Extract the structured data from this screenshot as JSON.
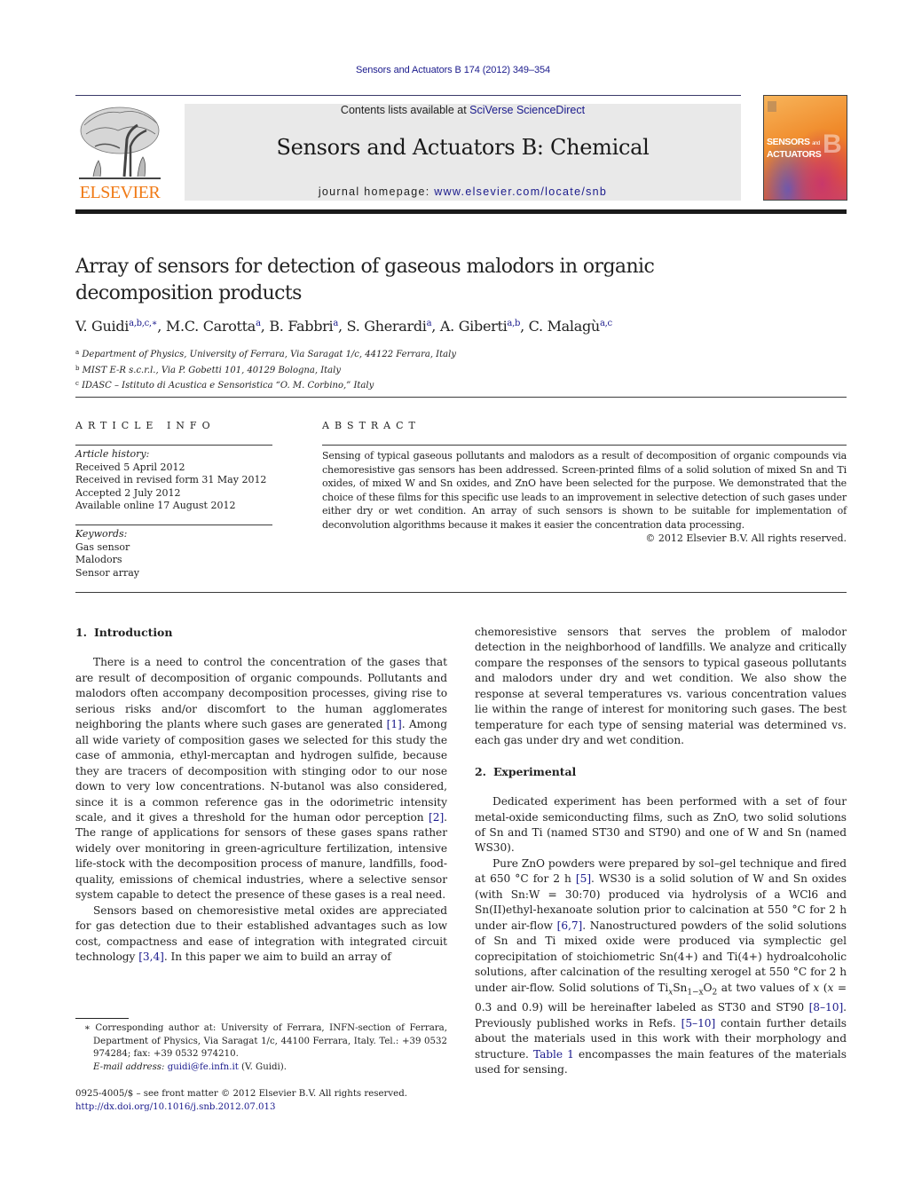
{
  "header": {
    "citation": "Sensors and Actuators B 174 (2012) 349–354",
    "contents_prefix": "Contents lists available at ",
    "contents_link": "SciVerse ScienceDirect",
    "journal_title": "Sensors and Actuators B: Chemical",
    "homepage_prefix": "journal homepage: ",
    "homepage_link": "www.elsevier.com/locate/snb",
    "publisher_logo_text": "ELSEVIER",
    "cover_title_line1": "SENSORS",
    "cover_title_and": "and",
    "cover_title_line2": "ACTUATORS",
    "cover_letter": "B",
    "brand_color": "#f07a16",
    "link_color": "#1a1a8c"
  },
  "article": {
    "title_line1": "Array of sensors for detection of gaseous malodors in organic",
    "title_line2": "decomposition products",
    "authors": [
      {
        "name": "V. Guidi",
        "sup": "a,b,c,∗"
      },
      {
        "name": "M.C. Carotta",
        "sup": "a"
      },
      {
        "name": "B. Fabbri",
        "sup": "a"
      },
      {
        "name": "S. Gherardi",
        "sup": "a"
      },
      {
        "name": "A. Giberti",
        "sup": "a,b"
      },
      {
        "name": "C. Malagù",
        "sup": "a,c"
      }
    ],
    "affiliations": [
      {
        "key": "a",
        "text": "Department of Physics, University of Ferrara, Via Saragat 1/c, 44122 Ferrara, Italy"
      },
      {
        "key": "b",
        "text": "MIST E-R s.c.r.l., Via P. Gobetti 101, 40129 Bologna, Italy"
      },
      {
        "key": "c",
        "text": "IDASC – Istituto di Acustica e Sensoristica “O. M. Corbino,” Italy"
      }
    ]
  },
  "article_info": {
    "heading": "ARTICLE INFO",
    "history_label": "Article history:",
    "history": [
      "Received 5 April 2012",
      "Received in revised form 31 May 2012",
      "Accepted 2 July 2012",
      "Available online 17 August 2012"
    ],
    "keywords_label": "Keywords:",
    "keywords": [
      "Gas sensor",
      "Malodors",
      "Sensor array"
    ]
  },
  "abstract": {
    "heading": "ABSTRACT",
    "text": "Sensing of typical gaseous pollutants and malodors as a result of decomposition of organic compounds via chemoresistive gas sensors has been addressed. Screen-printed films of a solid solution of mixed Sn and Ti oxides, of mixed W and Sn oxides, and ZnO have been selected for the purpose. We demonstrated that the choice of these films for this specific use leads to an improvement in selective detection of such gases under either dry or wet condition. An array of such sensors is shown to be suitable for implementation of deconvolution algorithms because it makes it easier the concentration data processing.",
    "copyright": "© 2012 Elsevier B.V. All rights reserved."
  },
  "body": {
    "sec1": {
      "num": "1.",
      "title": "Introduction",
      "p1_a": "There is a need to control the concentration of the gases that are result of decomposition of organic compounds. Pollutants and malodors often accompany decomposition processes, giving rise to serious risks and/or discomfort to the human agglomerates neighboring the plants where such gases are generated ",
      "p1_ref1": "[1]",
      "p1_b": ". Among all wide variety of composition gases we selected for this study the case of ammonia, ethyl-mercaptan and hydrogen sulfide, because they are tracers of decomposition with stinging odor to our nose down to very low concentrations. N-butanol was also considered, since it is a common reference gas in the odorimetric intensity scale, and it gives a threshold for the human odor perception ",
      "p1_ref2": "[2]",
      "p1_c": ". The range of applications for sensors of these gases spans rather widely over monitoring in green-agriculture fertilization, intensive life-stock with the decomposition process of manure, landfills, food-quality, emissions of chemical industries, where a selective sensor system capable to detect the presence of these gases is a real need.",
      "p2_a": "Sensors based on chemoresistive metal oxides are appreciated for gas detection due to their established advantages such as low cost, compactness and ease of integration with integrated circuit technology ",
      "p2_ref": "[3,4]",
      "p2_b": ". In this paper we aim to build an array of ",
      "p2_c": "chemoresistive sensors that serves the problem of malodor detection in the neighborhood of landfills. We analyze and critically compare the responses of the sensors to typical gaseous pollutants and malodors under dry and wet condition. We also show the response at several temperatures vs. various concentration values lie within the range of interest for monitoring such gases. The best temperature for each type of sensing material was determined vs. each gas under dry and wet condition."
    },
    "sec2": {
      "num": "2.",
      "title": "Experimental",
      "p1": "Dedicated experiment has been performed with a set of four metal-oxide semiconducting films, such as ZnO, two solid solutions of Sn and Ti (named ST30 and ST90) and one of W and Sn (named WS30).",
      "p2_a": "Pure ZnO powders were prepared by sol–gel technique and fired at 650 °C for 2 h ",
      "p2_ref1": "[5]",
      "p2_b": ". WS30 is a solid solution of W and Sn oxides (with Sn:W = 30:70) produced via hydrolysis of a WCl6 and Sn(II)ethyl-hexanoate solution prior to calcination at 550 °C for 2 h under air-flow ",
      "p2_ref2": "[6,7]",
      "p2_c": ". Nanostructured powders of the solid solutions of Sn and Ti mixed oxide were produced via symplectic gel coprecipitation of stoichiometric Sn(4+) and Ti(4+) hydroalcoholic solutions, after calcination of the resulting xerogel at 550 °C for 2 h under air-flow. Solid solutions of Ti",
      "p2_sub_x": "x",
      "p2_sn": "Sn",
      "p2_sub_1x": "1−x",
      "p2_o": "O",
      "p2_sub_2": "2",
      "p2_d": " at two values of ",
      "p2_x_italic": "x",
      "p2_e": " (",
      "p2_x_italic2": "x",
      "p2_f": " = 0.3 and 0.9) will be hereinafter labeled as ST30 and ST90 ",
      "p2_ref3": "[8–10]",
      "p2_g": ". Previously published works in Refs. ",
      "p2_ref4": "[5–10]",
      "p2_h": " contain further details about the materials used in this work with their morphology and structure. ",
      "p2_table_ref": "Table 1",
      "p2_i": " encompasses the main features of the materials used for sensing."
    }
  },
  "footnotes": {
    "corresponding": "∗ Corresponding author at: University of Ferrara, INFN-section of Ferrara, Department of Physics, Via Saragat 1/c, 44100 Ferrara, Italy. Tel.: +39 0532 974284; fax: +39 0532 974210.",
    "email_label": "E-mail address: ",
    "email": "guidi@fe.infn.it",
    "email_suffix": " (V. Guidi).",
    "issn": "0925-4005/$ – see front matter © 2012 Elsevier B.V. All rights reserved.",
    "doi": "http://dx.doi.org/10.1016/j.snb.2012.07.013"
  }
}
